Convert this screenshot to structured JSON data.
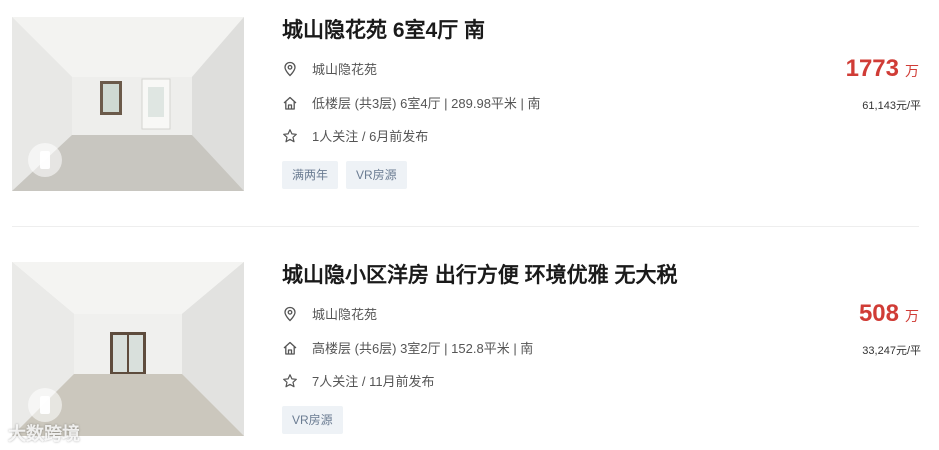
{
  "listings": [
    {
      "title": "城山隐花苑 6室4厅 南",
      "community": "城山隐花苑",
      "house_info": "低楼层 (共3层) 6室4厅 | 289.98平米 | 南",
      "follow_info": "1人关注 / 6月前发布",
      "tags": [
        "满两年",
        "VR房源"
      ],
      "total_price": "1773",
      "price_unit": "万",
      "unit_price": "61,143元/平"
    },
    {
      "title": "城山隐小区洋房 出行方便 环境优雅 无大税",
      "community": "城山隐花苑",
      "house_info": "高楼层 (共6层) 3室2厅 | 152.8平米 | 南",
      "follow_info": "7人关注 / 11月前发布",
      "tags": [
        "VR房源"
      ],
      "total_price": "508",
      "price_unit": "万",
      "unit_price": "33,247元/平"
    }
  ],
  "watermark": "大数跨境",
  "colors": {
    "price": "#d03c36",
    "tag_bg": "#eef2f6",
    "tag_text": "#6b7c92"
  },
  "icons": [
    "location-pin-icon",
    "house-icon",
    "star-icon",
    "vr-icon"
  ]
}
